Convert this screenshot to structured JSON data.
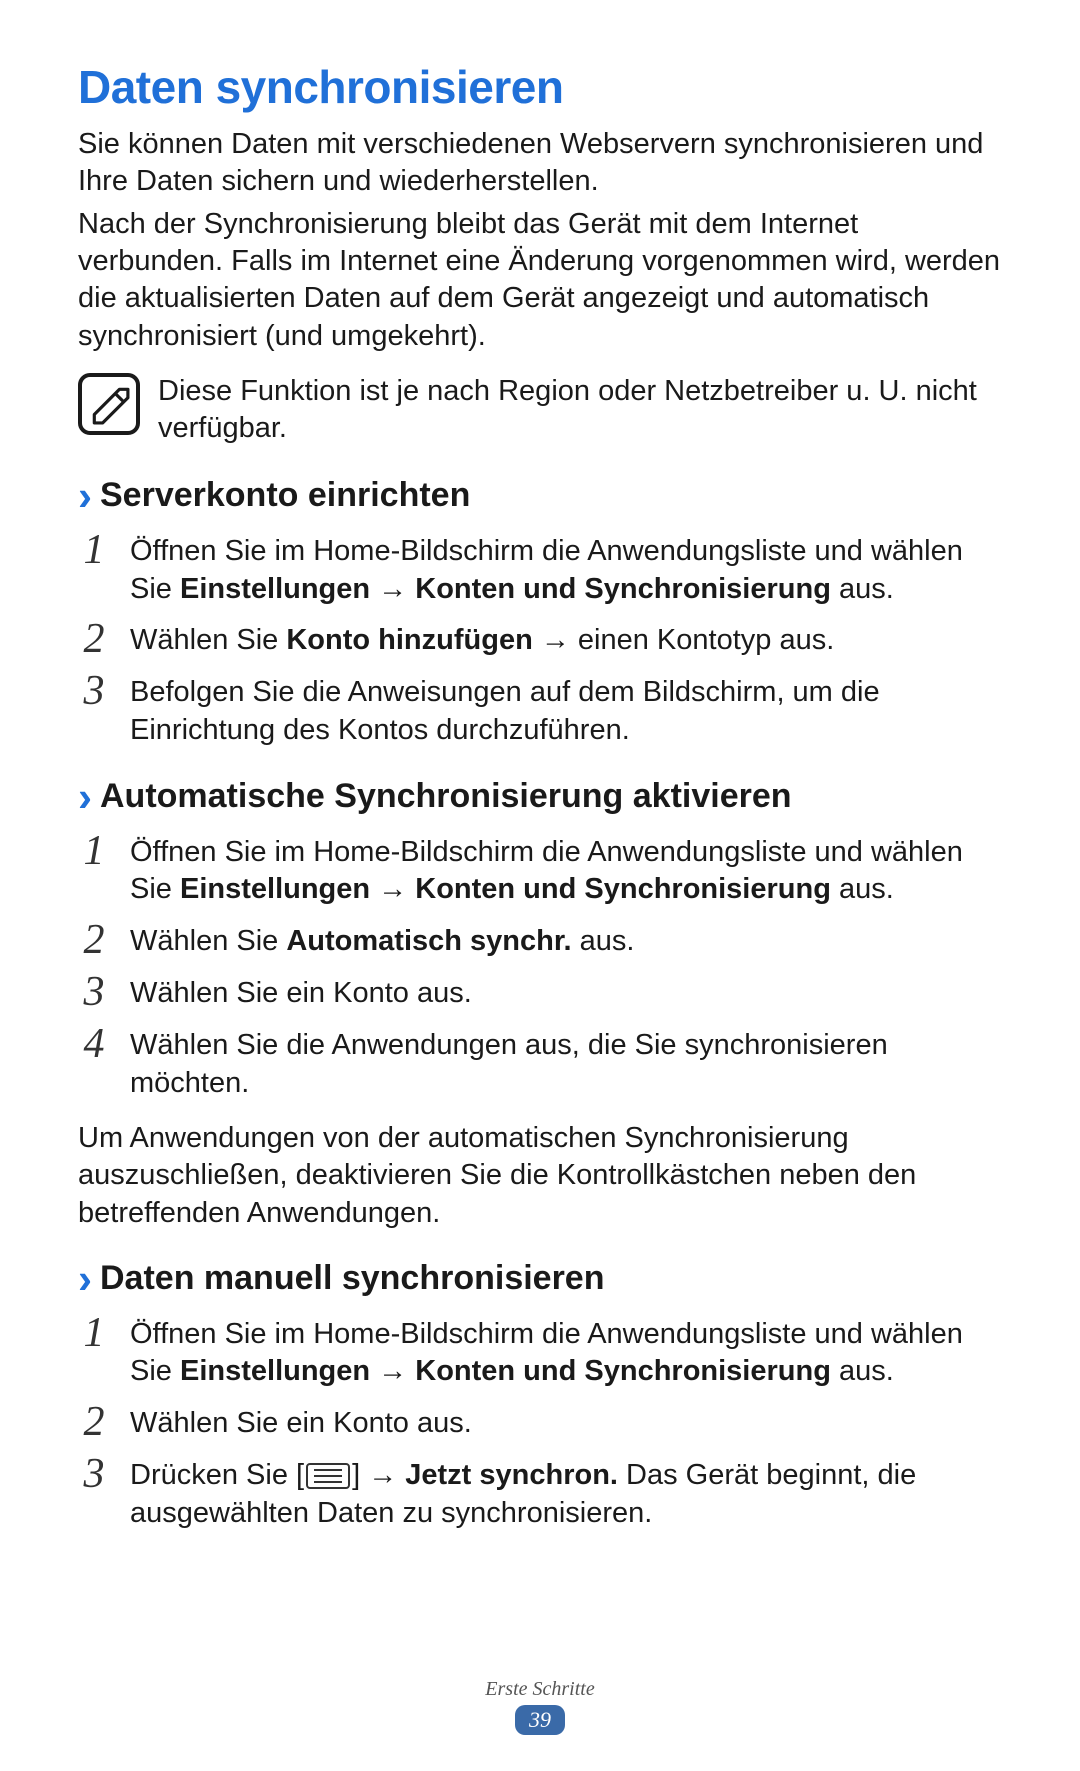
{
  "title": "Daten synchronisieren",
  "intro1": "Sie können Daten mit verschiedenen Webservern synchronisieren und Ihre Daten sichern und wiederherstellen.",
  "intro2": "Nach der Synchronisierung bleibt das Gerät mit dem Internet verbunden. Falls im Internet eine Änderung vorgenommen wird, werden die aktualisierten Daten auf dem Gerät angezeigt und automatisch synchronisiert (und umgekehrt).",
  "note": "Diese Funktion ist je nach Region oder Netzbetreiber u. U. nicht verfügbar.",
  "sections": {
    "s1": {
      "heading": "Serverkonto einrichten",
      "steps": {
        "n1": "1",
        "t1a": "Öffnen Sie im Home-Bildschirm die Anwendungsliste und wählen Sie ",
        "t1b": "Einstellungen",
        "t1c": " → ",
        "t1d": "Konten und Synchronisierung",
        "t1e": " aus.",
        "n2": "2",
        "t2a": "Wählen Sie ",
        "t2b": "Konto hinzufügen",
        "t2c": " → einen Kontotyp aus.",
        "n3": "3",
        "t3": "Befolgen Sie die Anweisungen auf dem Bildschirm, um die Einrichtung des Kontos durchzuführen."
      }
    },
    "s2": {
      "heading": "Automatische Synchronisierung aktivieren",
      "steps": {
        "n1": "1",
        "t1a": "Öffnen Sie im Home-Bildschirm die Anwendungsliste und wählen Sie ",
        "t1b": "Einstellungen",
        "t1c": " → ",
        "t1d": "Konten und Synchronisierung",
        "t1e": " aus.",
        "n2": "2",
        "t2a": "Wählen Sie ",
        "t2b": "Automatisch synchr.",
        "t2c": " aus.",
        "n3": "3",
        "t3": "Wählen Sie ein Konto aus.",
        "n4": "4",
        "t4": "Wählen Sie die Anwendungen aus, die Sie synchronisieren möchten."
      },
      "after": "Um Anwendungen von der automatischen Synchronisierung auszuschließen, deaktivieren Sie die Kontrollkästchen neben den betreffenden Anwendungen."
    },
    "s3": {
      "heading": "Daten manuell synchronisieren",
      "steps": {
        "n1": "1",
        "t1a": "Öffnen Sie im Home-Bildschirm die Anwendungsliste und wählen Sie ",
        "t1b": "Einstellungen",
        "t1c": " → ",
        "t1d": "Konten und Synchronisierung",
        "t1e": " aus.",
        "n2": "2",
        "t2": "Wählen Sie ein Konto aus.",
        "n3": "3",
        "t3a": "Drücken Sie [",
        "t3b": "] → ",
        "t3c": "Jetzt synchron.",
        "t3d": " Das Gerät beginnt, die ausgewählten Daten zu synchronisieren."
      }
    }
  },
  "footer": {
    "section": "Erste Schritte",
    "page": "39"
  }
}
